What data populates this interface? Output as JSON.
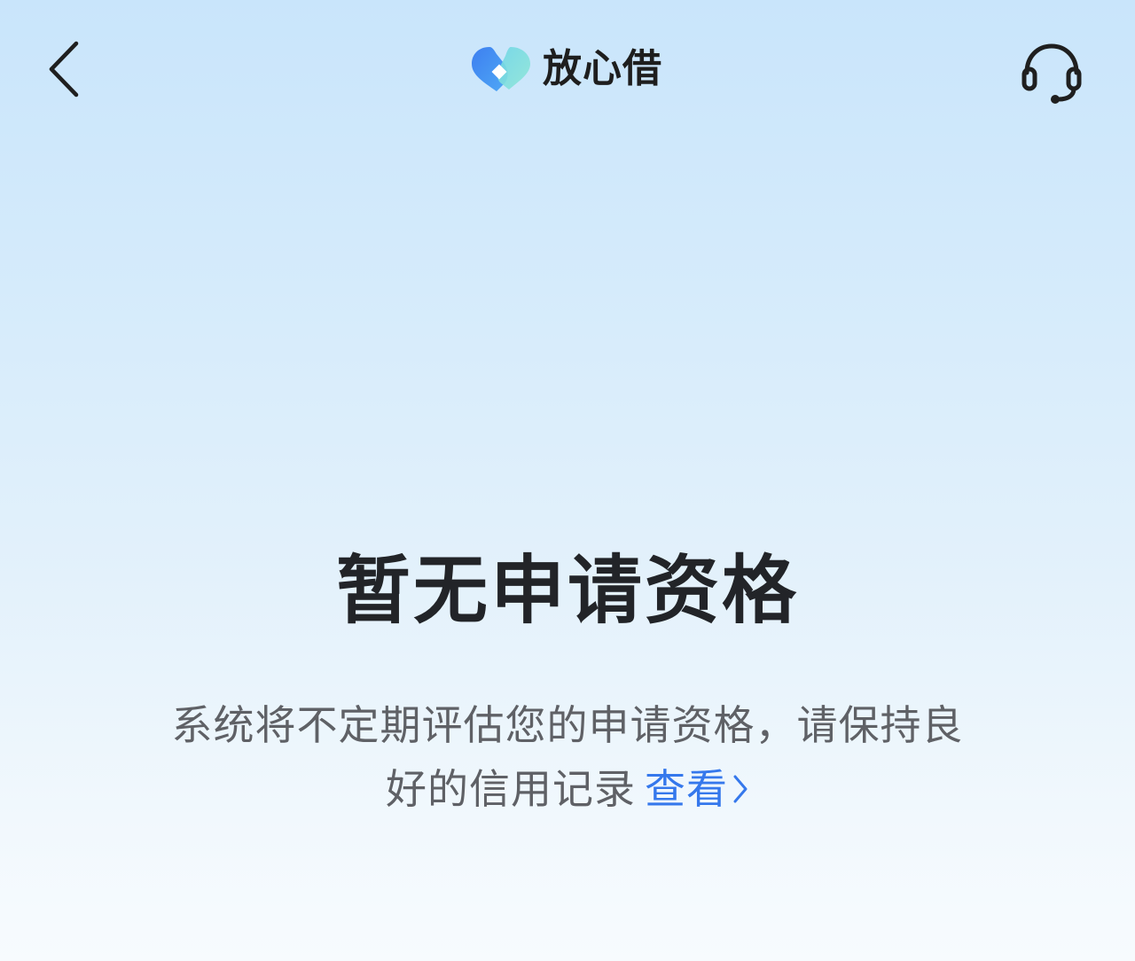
{
  "header": {
    "app_name": "放心借",
    "back_icon": "chevron-left-icon",
    "service_icon": "headset-icon",
    "logo_colors": [
      "#3d7ff0",
      "#59c6f2",
      "#7fe1d8"
    ]
  },
  "main": {
    "title": "暂无申请资格",
    "description_line1": "系统将不定期评估您的申请资格，请保持良",
    "description_line2": "好的信用记录",
    "view_link_label": "查看",
    "view_link_icon": "chevron-right-icon"
  },
  "colors": {
    "link": "#3578ec",
    "title": "#222428",
    "text": "#5f6166"
  }
}
